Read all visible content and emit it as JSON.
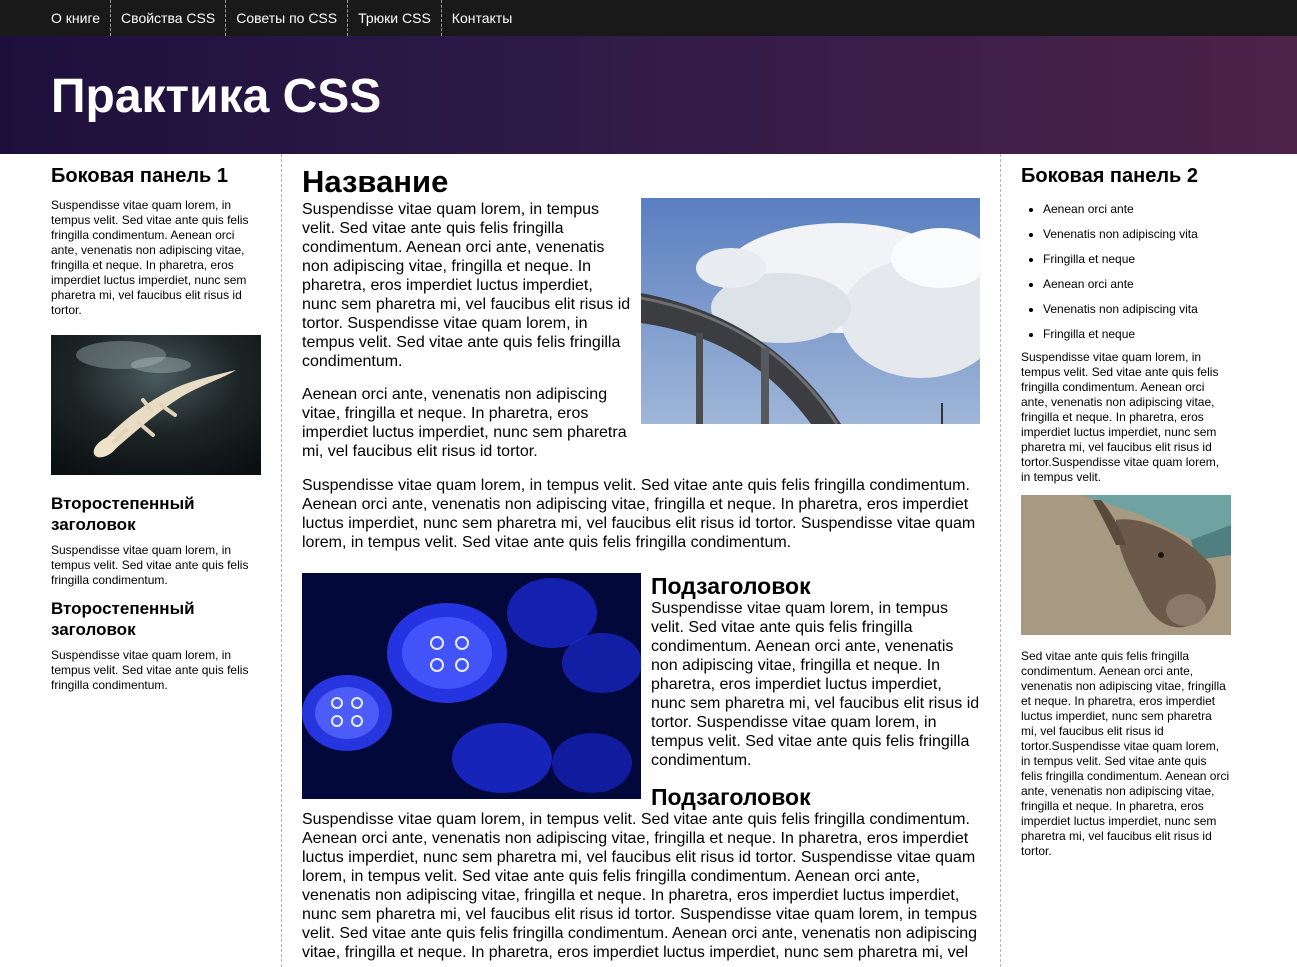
{
  "nav": {
    "items": [
      "О книге",
      "Свойства CSS",
      "Советы по CSS",
      "Трюки CSS",
      "Контакты"
    ]
  },
  "header": {
    "title": "Практика CSS"
  },
  "sidebar1": {
    "title": "Боковая панель 1",
    "text": "Suspendisse vitae quam lorem, in tempus velit. Sed vitae ante quis felis fringilla condimentum. Aenean orci ante, venenatis non adipiscing vitae, fringilla et neque. In pharetra, eros imperdiet luctus imperdiet, nunc sem pharetra mi, vel faucibus elit risus id tortor.",
    "image": "albino-alligator-photo",
    "sections": [
      {
        "heading": "Второстепенный заголовок",
        "text": "Suspendisse vitae quam lorem, in tempus velit. Sed vitae ante quis felis fringilla condimentum."
      },
      {
        "heading": "Второстепенный заголовок",
        "text": "Suspendisse vitae quam lorem, in tempus velit. Sed vitae ante quis felis fringilla condimentum."
      }
    ]
  },
  "main": {
    "title": "Название",
    "image1": "highway-clouds-photo",
    "p1": "Suspendisse vitae quam lorem, in tempus velit. Sed vitae ante quis felis fringilla condimentum. Aenean orci ante, venenatis non adipiscing vitae, fringilla et neque. In pharetra, eros imperdiet luctus imperdiet, nunc sem pharetra mi, vel faucibus elit risus id tortor. Suspendisse vitae quam lorem, in tempus velit. Sed vitae ante quis felis fringilla condimentum.",
    "p2": "Aenean orci ante, venenatis non adipiscing vitae, fringilla et neque. In pharetra, eros imperdiet luctus imperdiet, nunc sem pharetra mi, vel faucibus elit risus id tortor.",
    "p3": "Suspendisse vitae quam lorem, in tempus velit. Sed vitae ante quis felis fringilla condimentum. Aenean orci ante, venenatis non adipiscing vitae, fringilla et neque. In pharetra, eros imperdiet luctus imperdiet, nunc sem pharetra mi, vel faucibus elit risus id tortor. Suspendisse vitae quam lorem, in tempus velit. Sed vitae ante quis felis fringilla condimentum.",
    "image2": "jellyfish-photo",
    "sub1": "Подзаголовок",
    "p4": "Suspendisse vitae quam lorem, in tempus velit. Sed vitae ante quis felis fringilla condimentum. Aenean orci ante, venenatis non adipiscing vitae, fringilla et neque. In pharetra, eros imperdiet luctus imperdiet, nunc sem pharetra mi, vel faucibus elit risus id tortor. Suspendisse vitae quam lorem, in tempus velit. Sed vitae ante quis felis fringilla condimentum.",
    "sub2": "Подзаголовок",
    "p5": "Suspendisse vitae quam lorem, in tempus velit. Sed vitae ante quis felis fringilla condimentum. Aenean orci ante, venenatis non adipiscing vitae, fringilla et neque. In pharetra, eros imperdiet luctus imperdiet, nunc sem pharetra mi, vel faucibus elit risus id tortor. Suspendisse vitae quam lorem, in tempus velit. Sed vitae ante quis felis fringilla condimentum. Aenean orci ante, venenatis non adipiscing vitae, fringilla et neque. In pharetra, eros imperdiet luctus imperdiet, nunc sem pharetra mi, vel faucibus elit risus id tortor. Suspendisse vitae quam lorem, in tempus velit. Sed vitae ante quis felis fringilla condimentum. Aenean orci ante, venenatis non adipiscing vitae, fringilla et neque. In pharetra, eros imperdiet luctus imperdiet, nunc sem pharetra mi, vel"
  },
  "sidebar2": {
    "title": "Боковая панель 2",
    "list": [
      "Aenean orci ante",
      "Venenatis non adipiscing vita",
      "Fringilla et neque",
      "Aenean orci ante",
      "Venenatis non adipiscing vita",
      "Fringilla et neque"
    ],
    "text1": "Suspendisse vitae quam lorem, in tempus velit. Sed vitae ante quis felis fringilla condimentum. Aenean orci ante, venenatis non adipiscing vitae, fringilla et neque. In pharetra, eros imperdiet luctus imperdiet, nunc sem pharetra mi, vel faucibus elit risus id tortor.Suspendisse vitae quam lorem, in tempus velit.",
    "image": "donkey-photo",
    "text2": "Sed vitae ante quis felis fringilla condimentum. Aenean orci ante, venenatis non adipiscing vitae, fringilla et neque. In pharetra, eros imperdiet luctus imperdiet, nunc sem pharetra mi, vel faucibus elit risus id tortor.Suspendisse vitae quam lorem, in tempus velit. Sed vitae ante quis felis fringilla condimentum. Aenean orci ante, venenatis non adipiscing vitae, fringilla et neque. In pharetra, eros imperdiet luctus imperdiet, nunc sem pharetra mi, vel faucibus elit risus id tortor."
  },
  "colors": {
    "nav_bg": "#191919",
    "header_start": "#1d0f3c",
    "header_end": "#4c2249"
  }
}
